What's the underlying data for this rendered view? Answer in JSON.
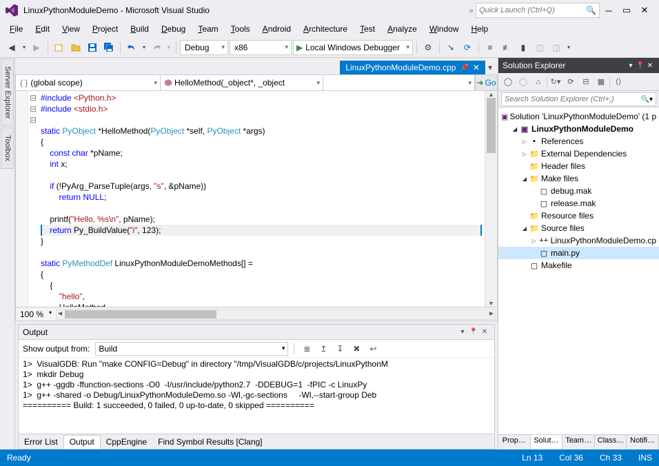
{
  "title": "LinuxPythonModuleDemo - Microsoft Visual Studio",
  "quicklaunch_placeholder": "Quick Launch (Ctrl+Q)",
  "menus": [
    "File",
    "Edit",
    "View",
    "Project",
    "Build",
    "Debug",
    "Team",
    "Tools",
    "Android",
    "Architecture",
    "Test",
    "Analyze",
    "Window",
    "Help"
  ],
  "toolbar": {
    "config": "Debug",
    "platform": "x86",
    "run": "Local Windows Debugger"
  },
  "left_tabs": [
    "Server Explorer",
    "Toolbox"
  ],
  "editor": {
    "tab": "LinuxPythonModuleDemo.cpp",
    "scope": "(global scope)",
    "member": "HelloMethod(_object*, _object",
    "go": "Go",
    "zoom": "100 %",
    "code_tokens": [
      [
        {
          "c": "kw",
          "t": "#include"
        },
        {
          "t": " "
        },
        {
          "c": "str",
          "t": "<Python.h>"
        }
      ],
      [
        {
          "c": "kw",
          "t": "#include"
        },
        {
          "t": " "
        },
        {
          "c": "str",
          "t": "<stdio.h>"
        }
      ],
      [],
      [
        {
          "c": "kw",
          "t": "static"
        },
        {
          "t": " "
        },
        {
          "c": "typ",
          "t": "PyObject"
        },
        {
          "t": " *HelloMethod("
        },
        {
          "c": "typ",
          "t": "PyObject"
        },
        {
          "t": " *self, "
        },
        {
          "c": "typ",
          "t": "PyObject"
        },
        {
          "t": " *args)"
        }
      ],
      [
        {
          "t": "{"
        }
      ],
      [
        {
          "t": "    "
        },
        {
          "c": "kw",
          "t": "const"
        },
        {
          "t": " "
        },
        {
          "c": "kw",
          "t": "char"
        },
        {
          "t": " *pName;"
        }
      ],
      [
        {
          "t": "    "
        },
        {
          "c": "kw",
          "t": "int"
        },
        {
          "t": " x;"
        }
      ],
      [],
      [
        {
          "t": "    "
        },
        {
          "c": "kw",
          "t": "if"
        },
        {
          "t": " (!PyArg_ParseTuple(args, "
        },
        {
          "c": "str",
          "t": "\"s\""
        },
        {
          "t": ", &pName))"
        }
      ],
      [
        {
          "t": "        "
        },
        {
          "c": "kw",
          "t": "return"
        },
        {
          "t": " "
        },
        {
          "c": "kw",
          "t": "NULL"
        },
        {
          "t": ";"
        }
      ],
      [],
      [
        {
          "t": "    printf("
        },
        {
          "c": "str",
          "t": "\"Hello, %s\\n\""
        },
        {
          "t": ", pName);"
        }
      ],
      [
        {
          "t": "    "
        },
        {
          "c": "kw",
          "t": "return"
        },
        {
          "t": " Py_BuildValue("
        },
        {
          "c": "str",
          "t": "\"i\""
        },
        {
          "t": ", 123);"
        }
      ],
      [
        {
          "t": "}"
        }
      ],
      [],
      [
        {
          "c": "kw",
          "t": "static"
        },
        {
          "t": " "
        },
        {
          "c": "typ",
          "t": "PyMethodDef"
        },
        {
          "t": " LinuxPythonModuleDemoMethods[] ="
        }
      ],
      [
        {
          "t": "{"
        }
      ],
      [
        {
          "t": "    {"
        }
      ],
      [
        {
          "t": "        "
        },
        {
          "c": "str",
          "t": "\"hello\""
        },
        {
          "t": ","
        }
      ],
      [
        {
          "t": "        HelloMethod,"
        }
      ]
    ],
    "outline": [
      "",
      "",
      "",
      "",
      "⊟",
      "",
      "",
      "",
      "",
      "",
      "",
      "",
      "",
      "",
      "",
      "",
      "⊟",
      "⊟",
      "",
      ""
    ],
    "current_line": 12
  },
  "output": {
    "title": "Output",
    "from_label": "Show output from:",
    "from_value": "Build",
    "lines": [
      "1>  VisualGDB: Run \"make CONFIG=Debug\" in directory \"/tmp/VisualGDB/c/projects/LinuxPythonM",
      "1>  mkdir Debug",
      "1>  g++ -ggdb -ffunction-sections -O0  -I/usr/include/python2.7  -DDEBUG=1  -fPIC -c LinuxPy",
      "1>  g++ -shared -o Debug/LinuxPythonModuleDemo.so -Wl,-gc-sections     -Wl,--start-group Deb",
      "========== Build: 1 succeeded, 0 failed, 0 up-to-date, 0 skipped =========="
    ]
  },
  "bottom_tabs": [
    "Error List",
    "Output",
    "CppEngine",
    "Find Symbol Results [Clang]"
  ],
  "bottom_active": 1,
  "solution_explorer": {
    "title": "Solution Explorer",
    "search_placeholder": "Search Solution Explorer (Ctrl+;)",
    "tree": [
      {
        "d": 0,
        "exp": "",
        "icon": "sln",
        "label": "Solution 'LinuxPythonModuleDemo' (1 p"
      },
      {
        "d": 1,
        "exp": "▢",
        "icon": "proj",
        "label": "LinuxPythonModuleDemo",
        "bold": true
      },
      {
        "d": 2,
        "exp": "▷",
        "icon": "ref",
        "label": "References"
      },
      {
        "d": 2,
        "exp": "▷",
        "icon": "fold",
        "label": "External Dependencies"
      },
      {
        "d": 2,
        "exp": "",
        "icon": "fold",
        "label": "Header files"
      },
      {
        "d": 2,
        "exp": "▢",
        "icon": "fold",
        "label": "Make files"
      },
      {
        "d": 3,
        "exp": "",
        "icon": "file",
        "label": "debug.mak"
      },
      {
        "d": 3,
        "exp": "",
        "icon": "file",
        "label": "release.mak"
      },
      {
        "d": 2,
        "exp": "",
        "icon": "fold",
        "label": "Resource files"
      },
      {
        "d": 2,
        "exp": "▢",
        "icon": "fold",
        "label": "Source files"
      },
      {
        "d": 3,
        "exp": "▷",
        "icon": "cpp",
        "label": "LinuxPythonModuleDemo.cp"
      },
      {
        "d": 3,
        "exp": "",
        "icon": "py",
        "label": "main.py",
        "selected": true
      },
      {
        "d": 2,
        "exp": "",
        "icon": "file",
        "label": "Makefile"
      }
    ]
  },
  "right_tabs": [
    "Prop…",
    "Solut…",
    "Team…",
    "Class…",
    "Notifi…"
  ],
  "right_active": 1,
  "status": {
    "ready": "Ready",
    "ln": "Ln 13",
    "col": "Col 36",
    "ch": "Ch 33",
    "ins": "INS"
  }
}
